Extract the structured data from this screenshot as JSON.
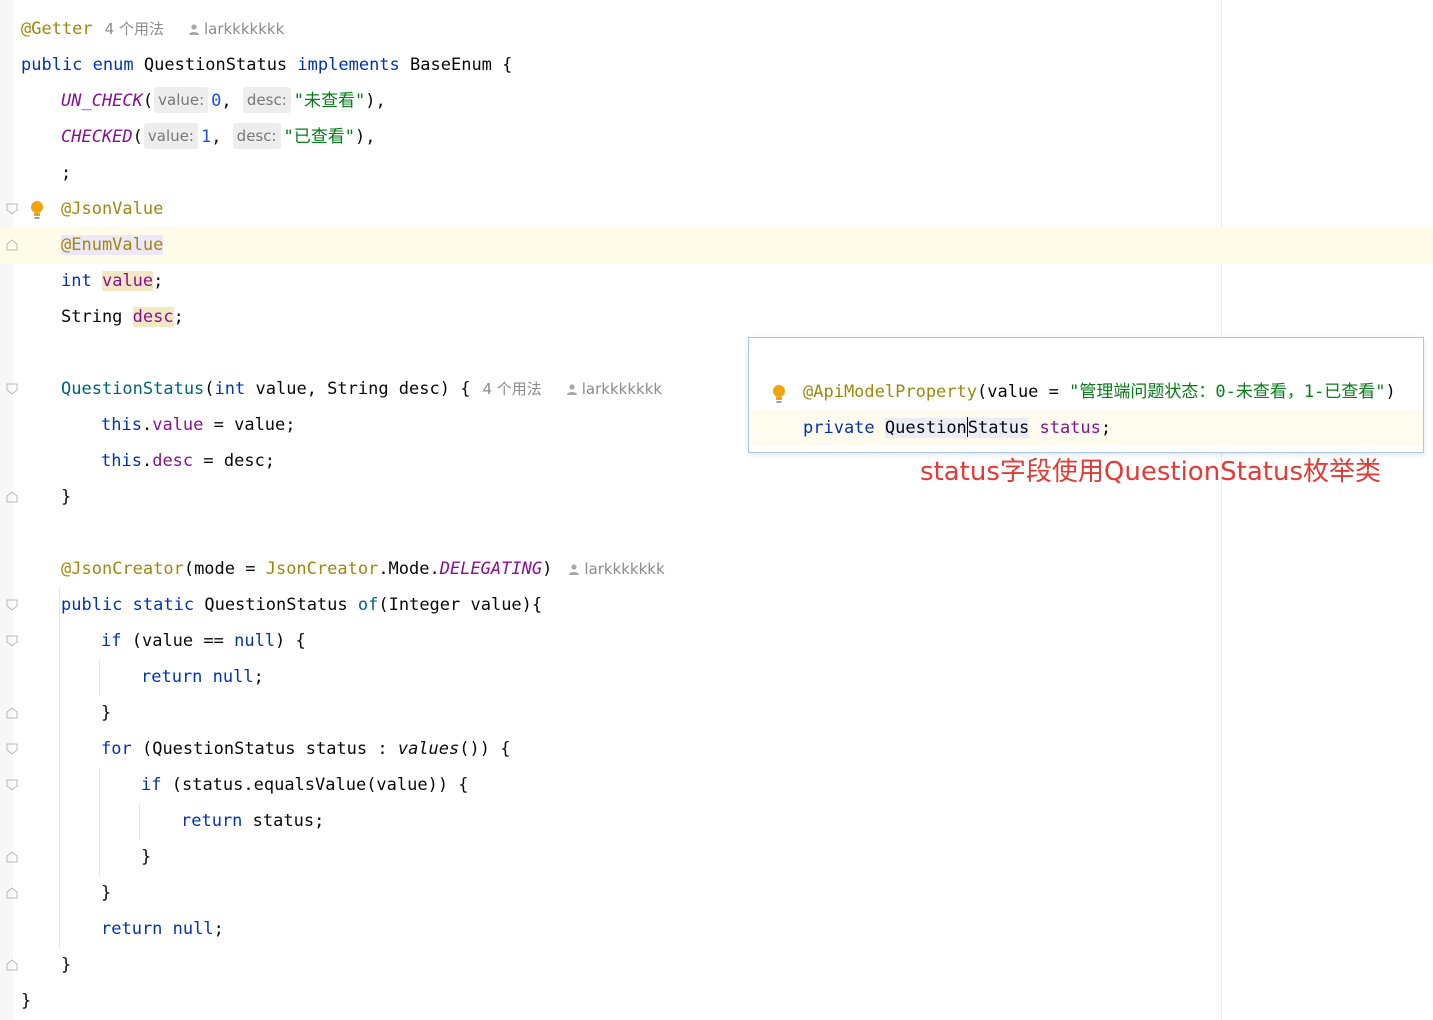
{
  "editor": {
    "lens_usages": "4 个用法",
    "author": "larkkkkkkk",
    "lines": {
      "getter": "@Getter",
      "decl_public": "public",
      "decl_enum": "enum",
      "decl_name": "QuestionStatus",
      "decl_implements": "implements",
      "decl_base": "BaseEnum {",
      "uncheck_name": "UN_CHECK",
      "checked_name": "CHECKED",
      "hint_value": "value:",
      "hint_desc": "desc:",
      "uncheck_val": "0",
      "uncheck_desc": "\"未查看\"",
      "checked_val": "1",
      "checked_desc": "\"已查看\"",
      "semicolon": ";",
      "json_value": "@JsonValue",
      "enum_value": "@EnumValue",
      "kw_int": "int",
      "field_value": "value",
      "type_string": "String",
      "field_desc": "desc",
      "ctor_name": "QuestionStatus",
      "ctor_params_a": "(",
      "ctor_params_b": " value, String desc) {",
      "kw_this": "this",
      "assign_value": " = value;",
      "assign_desc": " = desc;",
      "close_brace": "}",
      "json_creator": "@JsonCreator",
      "creator_mode": "(mode = ",
      "creator_class": "JsonCreator",
      "creator_mode2": ".Mode.",
      "creator_delegating": "DELEGATING",
      "creator_close": ")",
      "kw_public": "public",
      "kw_static": "static",
      "of_type": "QuestionStatus",
      "of_name": "of",
      "of_params": "(Integer value){",
      "kw_if": "if",
      "if_null_a": "(value == ",
      "kw_null": "null",
      "if_null_b": ") {",
      "kw_return": "return",
      "kw_for": "for",
      "for_body_a": "(QuestionStatus status : ",
      "for_values": "values",
      "for_body_b": "()) {",
      "if_equals": "(status.equalsValue(value)) {",
      "return_status": "status;"
    }
  },
  "popup": {
    "annotation": "@ApiModelProperty",
    "ann_args_a": "(value = ",
    "ann_string": "\"管理端问题状态：0-未查看，1-已查看\"",
    "ann_args_b": ")",
    "kw_private": "private",
    "type_a": "Question",
    "type_b": "Status",
    "field": "status",
    "semi": ";"
  },
  "note": "status字段使用QuestionStatus枚举类",
  "colors": {
    "keyword": "#0033b3",
    "annotation": "#9e880d",
    "field": "#871094",
    "string": "#067d17",
    "number": "#1750eb",
    "note": "#e53935"
  }
}
